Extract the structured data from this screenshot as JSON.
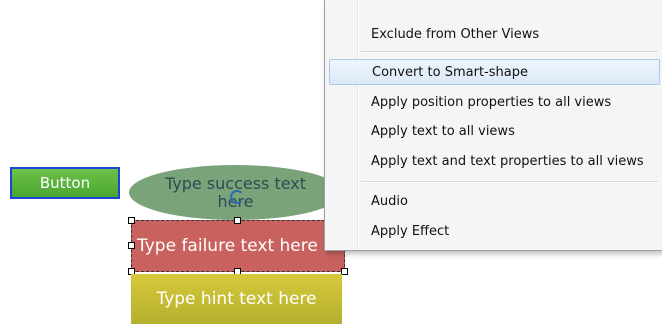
{
  "button": {
    "label": "Button"
  },
  "success": {
    "text": "Type success text here"
  },
  "failure": {
    "text": "Type failure text here"
  },
  "hint": {
    "text": "Type hint text here"
  },
  "context_menu": {
    "items": [
      {
        "label": "Exclude from Other Views"
      },
      {
        "label": "Convert to Smart-shape"
      },
      {
        "label": "Apply position properties to all views"
      },
      {
        "label": "Apply text to all views"
      },
      {
        "label": "Apply text and text properties to all views"
      },
      {
        "label": "Audio"
      },
      {
        "label": "Apply Effect"
      }
    ]
  },
  "colors": {
    "button_bg": "#5cb53c",
    "button_border": "#1a46d6",
    "success_bg": "#7aa37a",
    "failure_bg": "#c9625e",
    "hint_bg": "#c9be36",
    "menu_bg": "#f5f5f5",
    "menu_hover": "#dce9f8"
  }
}
